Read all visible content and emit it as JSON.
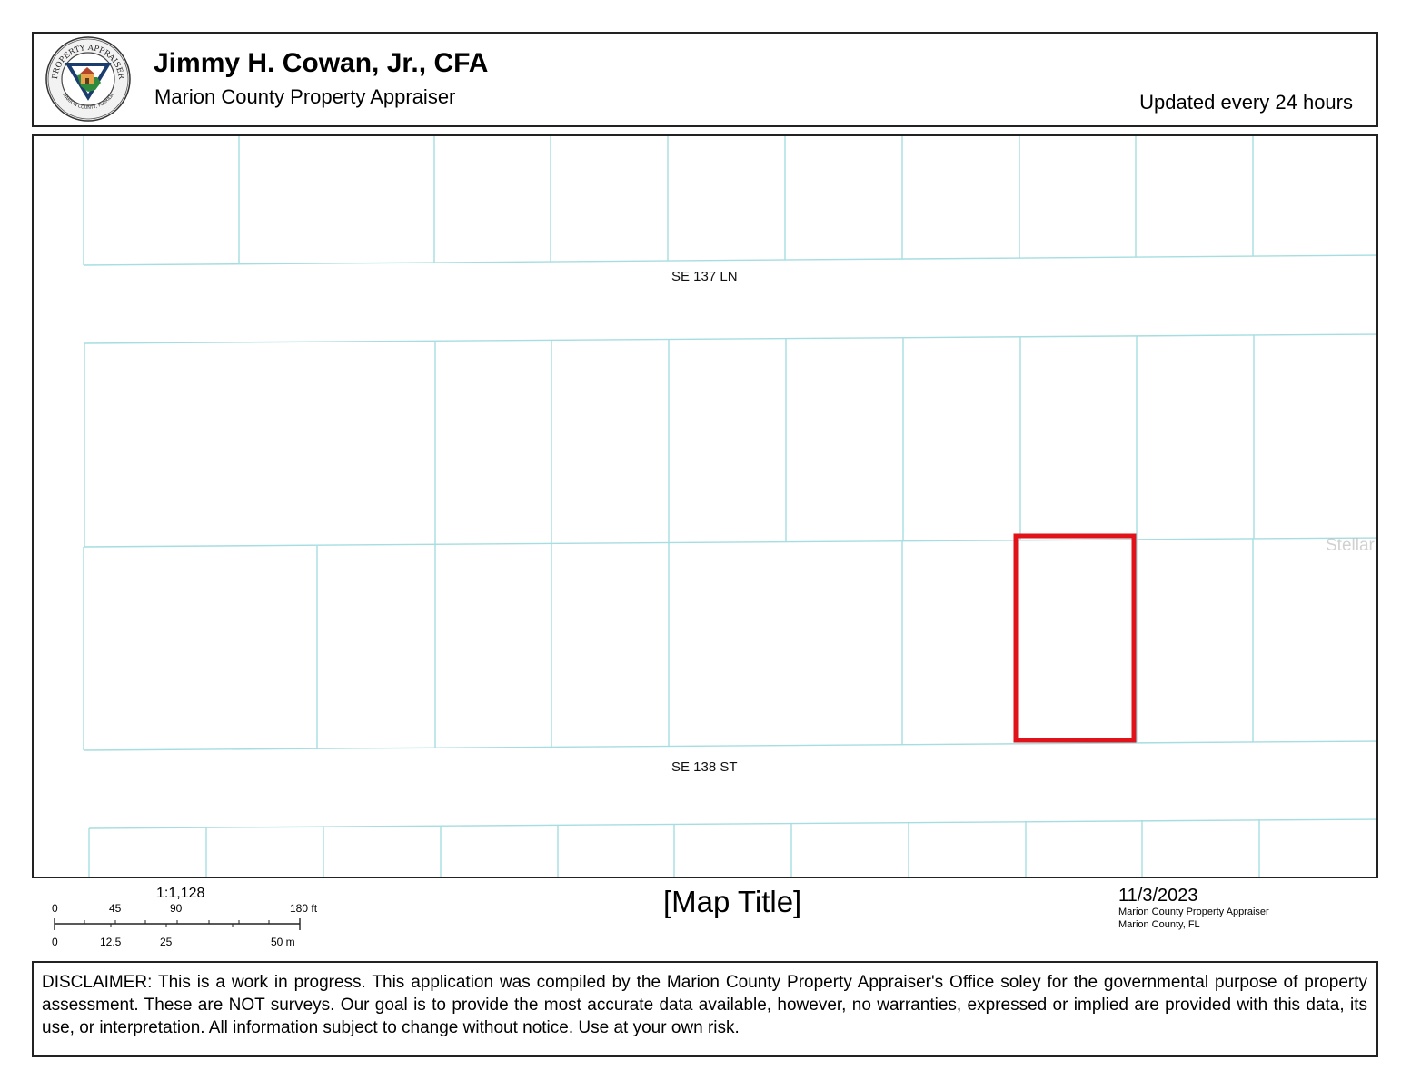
{
  "header": {
    "appraiser_name": "Jimmy H. Cowan, Jr., CFA",
    "office": "Marion County Property Appraiser",
    "update_note": "Updated every 24 hours",
    "seal": {
      "top_text": "PROPERTY APPRAISER",
      "bottom_text": "MARION COUNTY, FLORIDA"
    }
  },
  "map": {
    "streets": [
      "SE 137 LN",
      "SE 138 ST"
    ],
    "watermark": "StellarMLS",
    "parcel_line_color": "#a6dde0",
    "highlight_color": "#e0121a"
  },
  "scale": {
    "ratio": "1:1,128",
    "feet_ticks": [
      "0",
      "45",
      "90",
      "180 ft"
    ],
    "meter_ticks": [
      "0",
      "12.5",
      "25",
      "50 m"
    ]
  },
  "map_title": "[Map Title]",
  "footer": {
    "date": "11/3/2023",
    "credit_lines": [
      "Marion County Property Appraiser",
      "Marion County, FL"
    ]
  },
  "disclaimer": "DISCLAIMER: This is a work in progress. This application was compiled by the Marion County Property Appraiser's Office soley for the governmental purpose of property assessment. These are NOT surveys. Our goal is to provide the most accurate data available, however, no warranties, expressed or implied are provided with this data, its use, or interpretation. All information subject to change without notice. Use at your own risk."
}
